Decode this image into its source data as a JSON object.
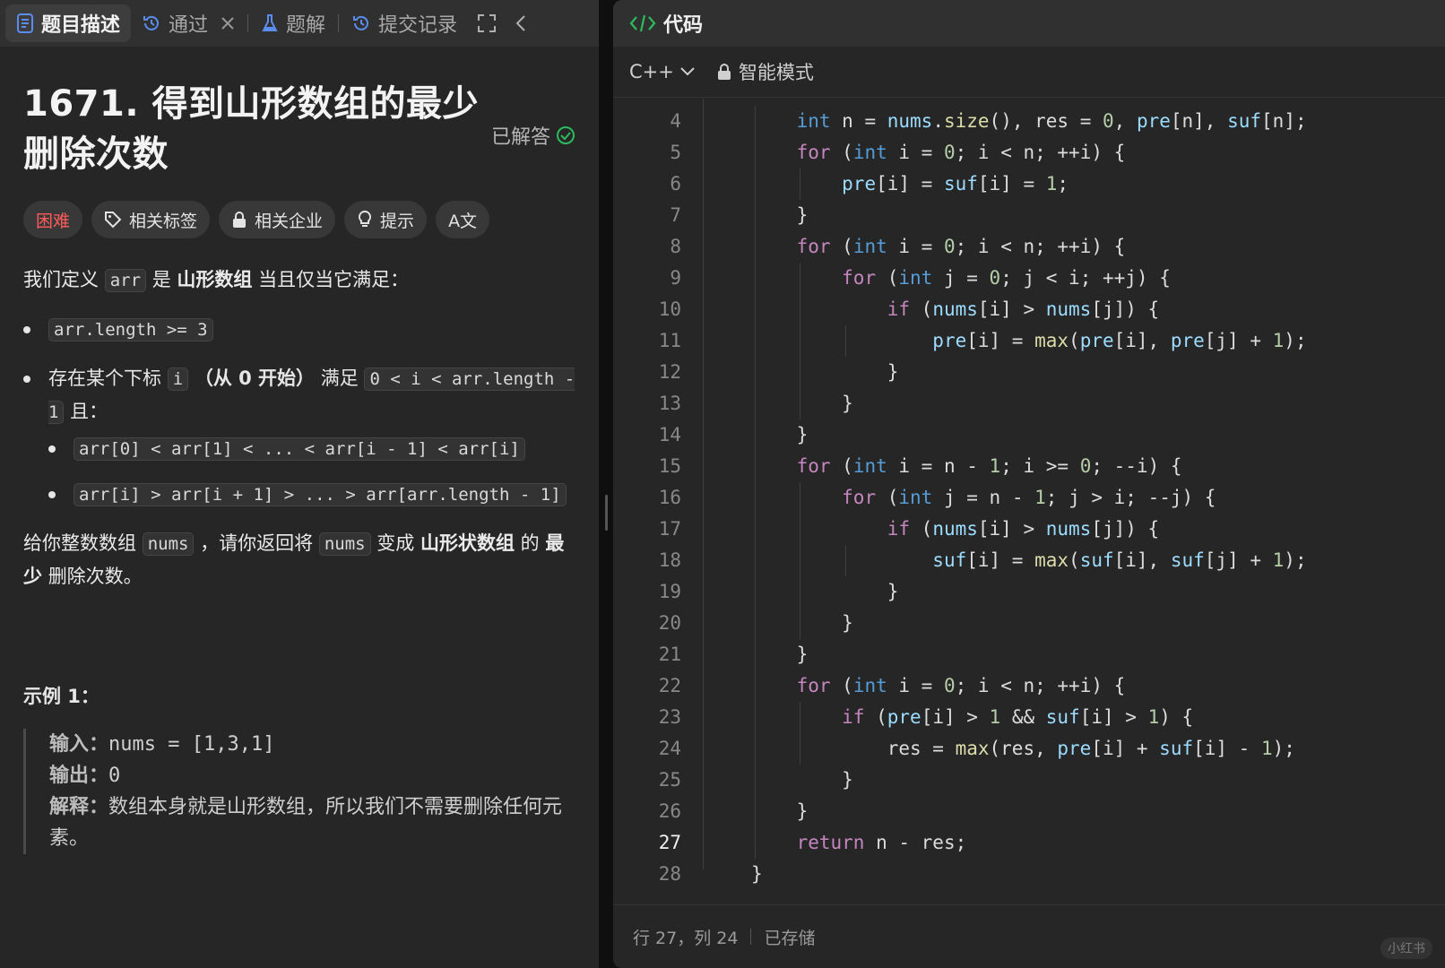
{
  "left_tabs": {
    "description": "题目描述",
    "passed": "通过",
    "solution": "题解",
    "submissions": "提交记录"
  },
  "problem": {
    "title": "1671. 得到山形数组的最少删除次数",
    "status": "已解答",
    "tags": {
      "difficulty": "困难",
      "related_tags": "相关标签",
      "related_companies": "相关企业",
      "hint": "提示",
      "translate": "A文"
    },
    "desc": {
      "p1_a": "我们定义",
      "p1_code": "arr",
      "p1_b": "是",
      "p1_bold": "山形数组",
      "p1_c": "当且仅当它满足：",
      "b1_code": "arr.length >= 3",
      "b2_a": "存在某个下标",
      "b2_code1": "i",
      "b2_bold": "（从 0 开始）",
      "b2_b": "满足",
      "b2_code2": "0 < i < arr.length - 1",
      "b2_c": "且：",
      "s1_code": "arr[0] < arr[1] < ... < arr[i - 1] < arr[i]",
      "s2_code": "arr[i] > arr[i + 1] > ... > arr[arr.length - 1]",
      "p2_a": "给你整数数组",
      "p2_code1": "nums",
      "p2_b": "，请你返回将",
      "p2_code2": "nums",
      "p2_c": "变成",
      "p2_bold": "山形状数组",
      "p2_d": "的",
      "p2_bold2": "最少",
      "p2_e": "删除次数。"
    },
    "example1": {
      "title": "示例 1：",
      "input_label": "输入：",
      "input": "nums = [1,3,1]",
      "output_label": "输出：",
      "output": "0",
      "explain_label": "解释：",
      "explain": "数组本身就是山形数组，所以我们不需要删除任何元素。"
    }
  },
  "editor": {
    "header": "代码",
    "language": "C++",
    "mode": "智能模式",
    "current_line": 27,
    "lines": [
      {
        "n": 4,
        "text": "    int n = nums.size(), res = 0, pre[n], suf[n];"
      },
      {
        "n": 5,
        "text": "    for (int i = 0; i < n; ++i) {"
      },
      {
        "n": 6,
        "text": "        pre[i] = suf[i] = 1;"
      },
      {
        "n": 7,
        "text": "    }"
      },
      {
        "n": 8,
        "text": "    for (int i = 0; i < n; ++i) {"
      },
      {
        "n": 9,
        "text": "        for (int j = 0; j < i; ++j) {"
      },
      {
        "n": 10,
        "text": "            if (nums[i] > nums[j]) {"
      },
      {
        "n": 11,
        "text": "                pre[i] = max(pre[i], pre[j] + 1);"
      },
      {
        "n": 12,
        "text": "            }"
      },
      {
        "n": 13,
        "text": "        }"
      },
      {
        "n": 14,
        "text": "    }"
      },
      {
        "n": 15,
        "text": "    for (int i = n - 1; i >= 0; --i) {"
      },
      {
        "n": 16,
        "text": "        for (int j = n - 1; j > i; --j) {"
      },
      {
        "n": 17,
        "text": "            if (nums[i] > nums[j]) {"
      },
      {
        "n": 18,
        "text": "                suf[i] = max(suf[i], suf[j] + 1);"
      },
      {
        "n": 19,
        "text": "            }"
      },
      {
        "n": 20,
        "text": "        }"
      },
      {
        "n": 21,
        "text": "    }"
      },
      {
        "n": 22,
        "text": "    for (int i = 0; i < n; ++i) {"
      },
      {
        "n": 23,
        "text": "        if (pre[i] > 1 && suf[i] > 1) {"
      },
      {
        "n": 24,
        "text": "            res = max(res, pre[i] + suf[i] - 1);"
      },
      {
        "n": 25,
        "text": "        }"
      },
      {
        "n": 26,
        "text": "    }"
      },
      {
        "n": 27,
        "text": "    return n - res;"
      },
      {
        "n": 28,
        "text": "}"
      }
    ],
    "status_position": "行 27，列 24",
    "status_saved": "已存储",
    "watermark": "小红书"
  }
}
